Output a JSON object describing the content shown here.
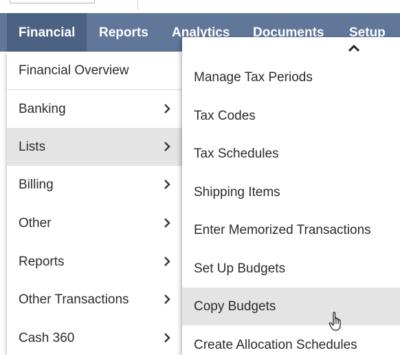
{
  "navbar": {
    "items": [
      {
        "label": "Financial",
        "active": true
      },
      {
        "label": "Reports"
      },
      {
        "label": "Analytics"
      },
      {
        "label": "Documents"
      },
      {
        "label": "Setup"
      }
    ]
  },
  "financial_menu": {
    "overview": "Financial Overview",
    "items": [
      {
        "label": "Banking",
        "icon": "chevron-right-icon"
      },
      {
        "label": "Lists",
        "icon": "chevron-right-icon",
        "highlighted": true
      },
      {
        "label": "Billing",
        "icon": "chevron-right-icon"
      },
      {
        "label": "Other",
        "icon": "chevron-right-icon"
      },
      {
        "label": "Reports",
        "icon": "chevron-right-icon"
      },
      {
        "label": "Other Transactions",
        "icon": "chevron-right-icon"
      },
      {
        "label": "Cash 360",
        "icon": "chevron-right-icon"
      }
    ]
  },
  "lists_submenu": {
    "scroll_icon": "chevron-up-icon",
    "items": [
      {
        "label": "Manage Tax Periods"
      },
      {
        "label": "Tax Codes"
      },
      {
        "label": "Tax Schedules"
      },
      {
        "label": "Shipping Items"
      },
      {
        "label": "Enter Memorized Transactions"
      },
      {
        "label": "Set Up Budgets"
      },
      {
        "label": "Copy Budgets",
        "highlighted": true
      },
      {
        "label": "Create Allocation Schedules"
      }
    ]
  },
  "colors": {
    "navbar": "#607799",
    "navbar_active": "#4c6283",
    "highlight": "#e4e4e4",
    "text": "#2b2b2b"
  },
  "cursor_icon": "hand-pointer-icon"
}
